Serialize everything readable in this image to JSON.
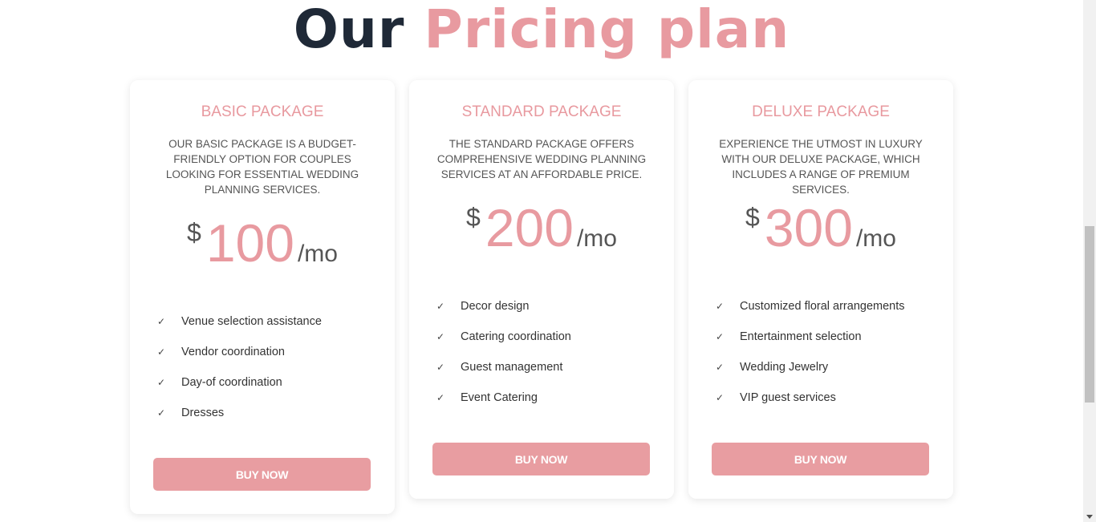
{
  "heading": {
    "word1": "Our",
    "word2": "Pricing plan"
  },
  "plans": [
    {
      "title": "BASIC PACKAGE",
      "description": "OUR BASIC PACKAGE IS A BUDGET-FRIENDLY OPTION FOR COUPLES LOOKING FOR ESSENTIAL WEDDING PLANNING SERVICES.",
      "currency": "$",
      "amount": "100",
      "period": "/mo",
      "features": [
        "Venue selection assistance",
        "Vendor coordination",
        "Day-of coordination",
        "Dresses"
      ],
      "button": "BUY NOW"
    },
    {
      "title": "STANDARD PACKAGE",
      "description": "THE STANDARD PACKAGE OFFERS COMPREHENSIVE WEDDING PLANNING SERVICES AT AN AFFORDABLE PRICE.",
      "currency": "$",
      "amount": "200",
      "period": "/mo",
      "features": [
        "Decor design",
        "Catering coordination",
        "Guest management",
        "Event Catering"
      ],
      "button": "BUY NOW"
    },
    {
      "title": "DELUXE PACKAGE",
      "description": "EXPERIENCE THE UTMOST IN LUXURY WITH OUR DELUXE PACKAGE, WHICH INCLUDES A RANGE OF PREMIUM SERVICES.",
      "currency": "$",
      "amount": "300",
      "period": "/mo",
      "features": [
        "Customized floral arrangements",
        "Entertainment selection",
        "Wedding Jewelry",
        "VIP guest services"
      ],
      "button": "BUY NOW"
    }
  ],
  "check_glyph": "✓",
  "colors": {
    "accent": "#e89aa0",
    "heading_dark": "#1f2937",
    "button": "#e89da1"
  }
}
